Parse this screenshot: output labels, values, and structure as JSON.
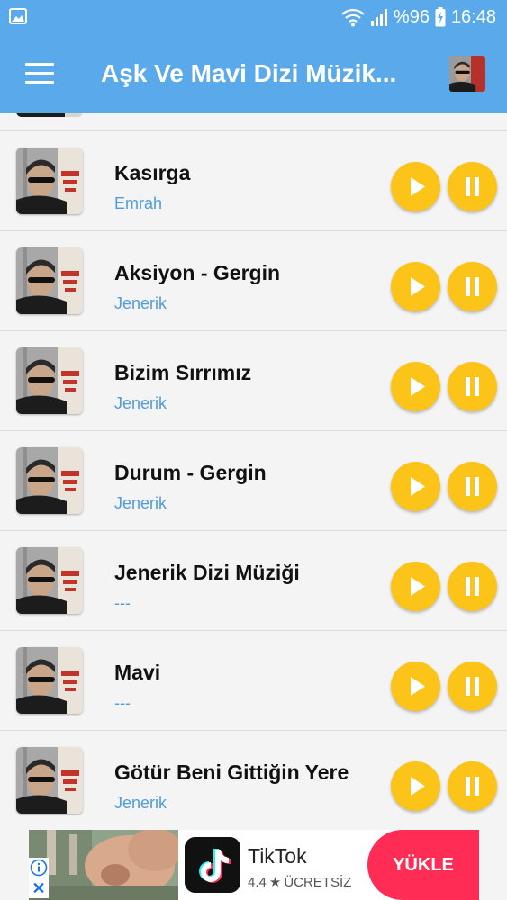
{
  "status_bar": {
    "battery_percent": "%96",
    "time": "16:48",
    "icons": [
      "gallery-icon",
      "wifi-icon",
      "signal-icon",
      "battery-charging-icon"
    ]
  },
  "app_bar": {
    "title": "Aşk Ve Mavi Dizi Müzik...",
    "menu_icon": "hamburger-menu-icon"
  },
  "songs": [
    {
      "title": "Kasırga",
      "artist": "Emrah"
    },
    {
      "title": "Aksiyon - Gergin",
      "artist": "Jenerik"
    },
    {
      "title": "Bizim Sırrımız",
      "artist": "Jenerik"
    },
    {
      "title": "Durum - Gergin",
      "artist": "Jenerik"
    },
    {
      "title": "Jenerik Dizi Müziği",
      "artist": "---"
    },
    {
      "title": "Mavi",
      "artist": "---"
    },
    {
      "title": "Götür Beni Gittiğin Yere",
      "artist": "Jenerik"
    }
  ],
  "buttons": {
    "play_icon": "play-icon",
    "pause_icon": "pause-icon"
  },
  "colors": {
    "app_bar": "#5aa9ea",
    "button": "#fcc419",
    "artist": "#4d9de0",
    "ad_button": "#ff2d55"
  },
  "ad": {
    "app_name": "TikTok",
    "rating": "4.4",
    "price": "ÜCRETSİZ",
    "install_label": "YÜKLE"
  }
}
